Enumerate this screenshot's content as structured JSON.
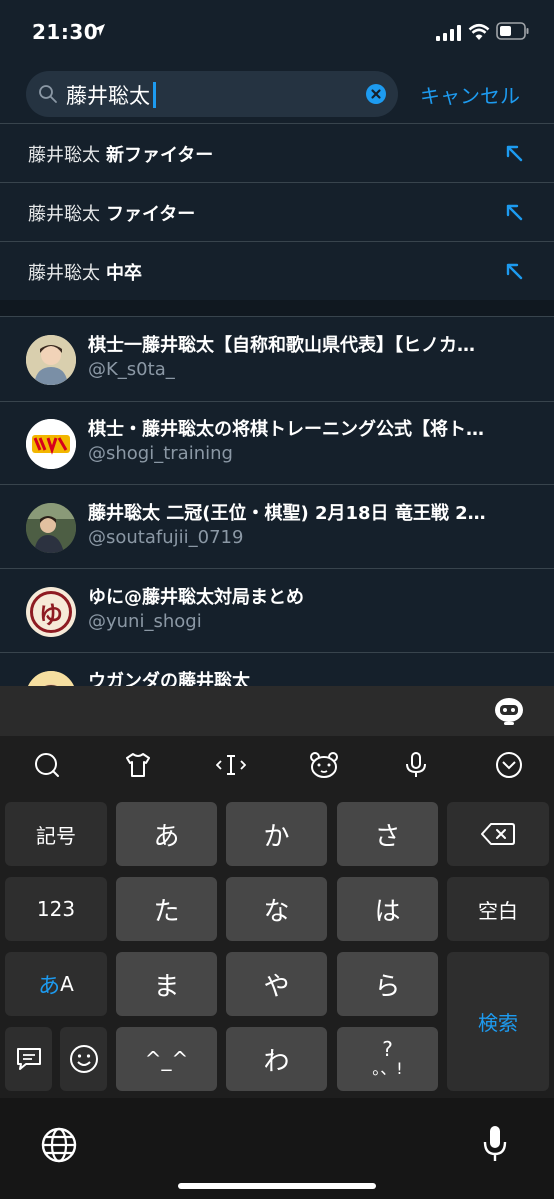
{
  "status_bar": {
    "time": "21:30"
  },
  "search": {
    "query": "藤井聡太",
    "cancel_label": "キャンセル"
  },
  "suggestions": [
    {
      "base": "藤井聡太",
      "suffix": "新ファイター"
    },
    {
      "base": "藤井聡太",
      "suffix": "ファイター"
    },
    {
      "base": "藤井聡太",
      "suffix": "中卒"
    }
  ],
  "users": [
    {
      "name": "棋士一藤井聡太【自称和歌山県代表】【ヒノカ…",
      "handle": "@K_s0ta_"
    },
    {
      "name": "棋士・藤井聡太の将棋トレーニング公式【将ト…",
      "handle": "@shogi_training"
    },
    {
      "name": "藤井聡太 二冠(王位・棋聖) 2月18日 竜王戦 2…",
      "handle": "@soutafujii_0719"
    },
    {
      "name": "ゆに@藤井聡太対局まとめ",
      "handle": "@yuni_shogi",
      "avatar_char": "ゆ"
    },
    {
      "name": "ウガンダの藤井聡太",
      "handle": ""
    }
  ],
  "keyboard": {
    "side_left": [
      "記号",
      "123",
      "あA"
    ],
    "kana_keys": [
      "あ",
      "か",
      "さ",
      "た",
      "な",
      "は",
      "ま",
      "や",
      "ら",
      "^_^",
      "わ",
      "?。、!"
    ],
    "side_right": {
      "space_label": "空白",
      "search_label": "検索"
    },
    "kigou": "記号",
    "num": "123",
    "kana_a": "あ",
    "kana_A": "A",
    "k_a": "あ",
    "k_ka": "か",
    "k_sa": "さ",
    "k_ta": "た",
    "k_na": "な",
    "k_ha": "は",
    "k_ma": "ま",
    "k_ya": "や",
    "k_ra": "ら",
    "k_face": "^_^",
    "k_wa": "わ",
    "k_q": "?",
    "k_punct": "。、!",
    "space": "空白",
    "search_key": "検索"
  },
  "colors": {
    "accent": "#1d9bf0",
    "background": "#15202b",
    "keyboard": "#1e1e1e"
  }
}
